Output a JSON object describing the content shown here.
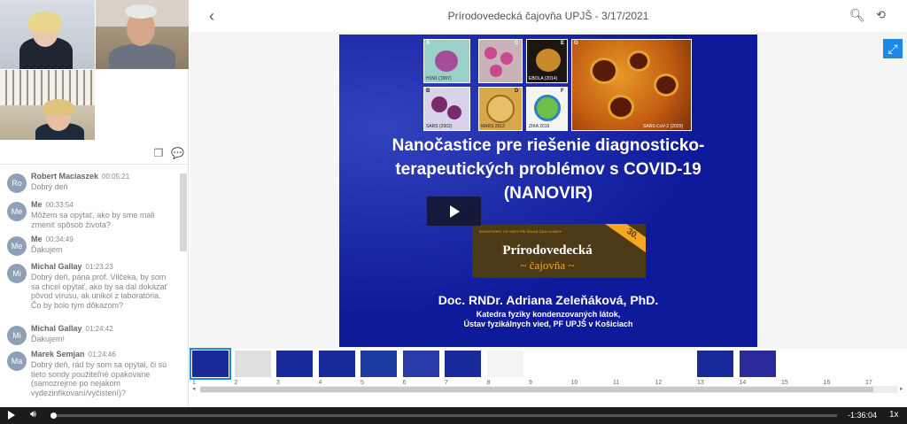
{
  "header": {
    "title": "Prírodovedecká čajovňa UPJŠ - 3/17/2021",
    "back_icon": "chevron-left-icon",
    "search_icon": "search-icon",
    "rotate_icon": "rotate-icon",
    "expand_icon": "expand-icon"
  },
  "chat": {
    "messages": [
      {
        "initials": "Ro",
        "name": "Robert Maciaszek",
        "time": "00:05:21",
        "text": "Dobrý deň"
      },
      {
        "initials": "Me",
        "name": "Me",
        "time": "00:33:54",
        "text": "Môžem sa opýtať, ako by sme mali zmeniť spôsob života?"
      },
      {
        "initials": "Me",
        "name": "Me",
        "time": "00:34:49",
        "text": "Ďakujem"
      },
      {
        "initials": "Mi",
        "name": "Michal Gallay",
        "time": "01:23:23",
        "text": "Dobrý deň, pána prof. Vilčeka, by som sa chcel opýtať, ako by sa dal dokázať pôvod vírusu, ak unikol z laboratória. Čo by bolo tým dôkazom?"
      },
      {
        "initials": "Mi",
        "name": "Michal Gallay",
        "time": "01:24:42",
        "text": "Ďakujem!"
      },
      {
        "initials": "Ma",
        "name": "Marek Semjan",
        "time": "01:24:46",
        "text": "Dobrý deň, rád by som sa opýtal, či sú tieto sondy použiteľné opakovane (samozrejme po nejakom vydezinfikovaní/vyčistení)?"
      }
    ]
  },
  "slide": {
    "title_line1": "Nanočastice pre riešenie diagnosticko-",
    "title_line2": "terapeutických problémov s COVID-19",
    "title_line3": "(NANOVIR)",
    "author": "Doc. RNDr. Adriana Zeleňáková, PhD.",
    "affiliation1": "Katedra fyziky kondenzovaných látok,",
    "affiliation2": "Ústav fyzikálnych vied, PF UPJŠ v Košiciach",
    "logo_title": "Prírodovedecká",
    "logo_sub": "~ čajovňa ~",
    "logo_tagline": "ROZHOVORY OD VEDY PRI ŠÁLKE ČAJU A KÁVY",
    "logo_badge": "30.",
    "virus_images": [
      {
        "letter": "A",
        "label": "H1N1 (1997)"
      },
      {
        "letter": "C",
        "label": ""
      },
      {
        "letter": "E",
        "label": "EBOLA (2014)"
      },
      {
        "letter": "B",
        "label": "SARS (2002)"
      },
      {
        "letter": "D",
        "label": "MARS 2012"
      },
      {
        "letter": "F",
        "label": "ZIKA 2016"
      },
      {
        "letter": "G",
        "label": "SARS-CoV-2 (2020)"
      }
    ]
  },
  "thumbnails": [
    "1",
    "2",
    "3",
    "4",
    "5",
    "6",
    "7",
    "8",
    "9",
    "10",
    "11",
    "12",
    "13",
    "14",
    "15",
    "16",
    "17"
  ],
  "player": {
    "time": "-1:36:04",
    "speed": "1x",
    "progress": 0.0
  }
}
